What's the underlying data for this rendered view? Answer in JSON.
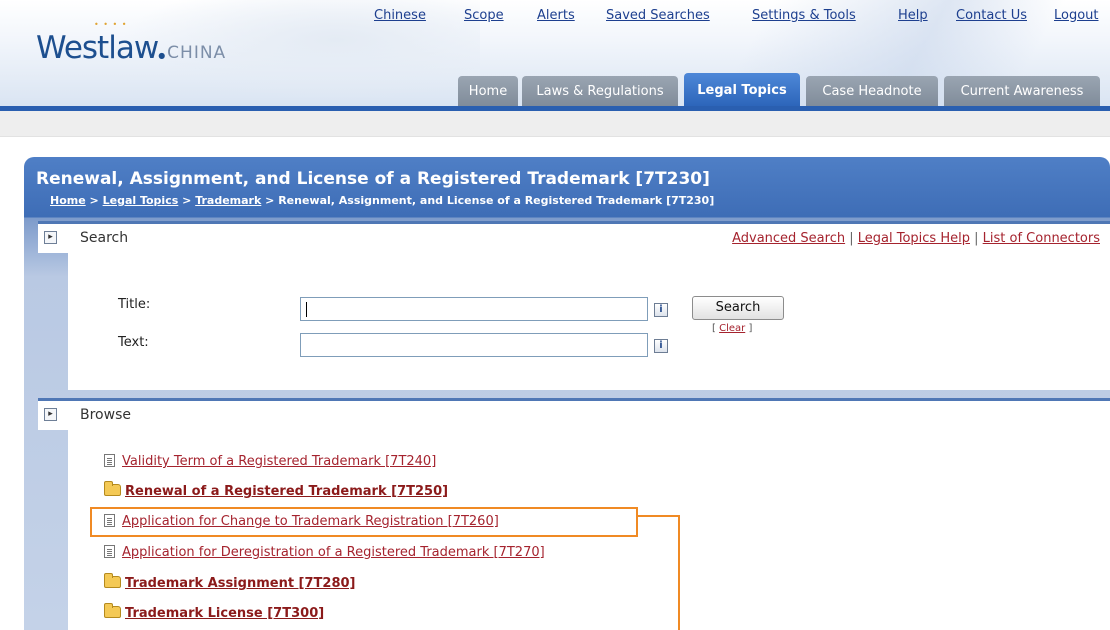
{
  "brand": {
    "name": "Westlaw",
    "sub": "CHINA"
  },
  "top_links": [
    "Chinese",
    "Scope",
    "Alerts",
    "Saved Searches",
    "Settings & Tools",
    "Help",
    "Contact Us",
    "Logout"
  ],
  "tabs": [
    {
      "label": "Home",
      "active": false
    },
    {
      "label": "Laws & Regulations",
      "active": false
    },
    {
      "label": "Legal Topics",
      "active": true
    },
    {
      "label": "Case Headnote",
      "active": false
    },
    {
      "label": "Current Awareness",
      "active": false
    }
  ],
  "page": {
    "title": "Renewal, Assignment, and License of a Registered Trademark [7T230]",
    "breadcrumb": {
      "home": "Home",
      "sep": ">",
      "legal_topics": "Legal Topics",
      "trademark": "Trademark",
      "current": "Renewal, Assignment, and License of a Registered Trademark [7T230]"
    }
  },
  "search": {
    "heading": "Search",
    "links": {
      "advanced": "Advanced Search",
      "help": "Legal Topics Help",
      "connectors": "List of Connectors",
      "separator": "|"
    },
    "title_label": "Title:",
    "text_label": "Text:",
    "title_value": "",
    "text_value": "",
    "info_glyph": "i",
    "button": "Search",
    "clear": {
      "open": "[",
      "label": "Clear",
      "close": "]"
    }
  },
  "browse": {
    "heading": "Browse",
    "items": [
      {
        "type": "document",
        "label": "Validity Term of a Registered Trademark [7T240]"
      },
      {
        "type": "folder",
        "label": "Renewal of a Registered Trademark [7T250]"
      },
      {
        "type": "document",
        "label": "Application for Change to Trademark Registration [7T260]",
        "highlighted": true
      },
      {
        "type": "document",
        "label": "Application for Deregistration of a Registered Trademark [7T270]"
      },
      {
        "type": "folder",
        "label": "Trademark Assignment [7T280]"
      },
      {
        "type": "folder",
        "label": "Trademark License [7T300]"
      }
    ]
  },
  "colors": {
    "brand_blue": "#1d4f8f",
    "link_red": "#a5232e",
    "highlight_orange": "#f08a24",
    "tab_active": "#2b63b8"
  }
}
